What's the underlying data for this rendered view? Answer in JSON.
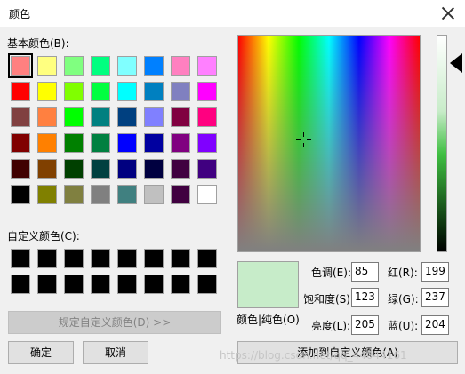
{
  "window": {
    "title": "颜色"
  },
  "basic": {
    "label": "基本颜色(B):",
    "swatches": [
      "#ff8080",
      "#ffff80",
      "#80ff80",
      "#00ff80",
      "#80ffff",
      "#0080ff",
      "#ff80c0",
      "#ff80ff",
      "#ff0000",
      "#ffff00",
      "#80ff00",
      "#00ff40",
      "#00ffff",
      "#0080c0",
      "#8080c0",
      "#ff00ff",
      "#804040",
      "#ff8040",
      "#00ff00",
      "#008080",
      "#004080",
      "#8080ff",
      "#800040",
      "#ff0080",
      "#800000",
      "#ff8000",
      "#008000",
      "#008040",
      "#0000ff",
      "#0000a0",
      "#800080",
      "#8000ff",
      "#400000",
      "#804000",
      "#004000",
      "#004040",
      "#000080",
      "#000040",
      "#400040",
      "#400080",
      "#000000",
      "#808000",
      "#808040",
      "#808080",
      "#408080",
      "#c0c0c0",
      "#400040",
      "#ffffff"
    ]
  },
  "custom": {
    "label": "自定义颜色(C):",
    "swatches": [
      "#000000",
      "#000000",
      "#000000",
      "#000000",
      "#000000",
      "#000000",
      "#000000",
      "#000000",
      "#000000",
      "#000000",
      "#000000",
      "#000000",
      "#000000",
      "#000000",
      "#000000",
      "#000000"
    ]
  },
  "buttons": {
    "define_custom": "规定自定义颜色(D) >>",
    "ok": "确定",
    "cancel": "取消",
    "add_custom": "添加到自定义颜色(A)"
  },
  "preview": {
    "color": "#c7ecc9",
    "label": "颜色|纯色(O)"
  },
  "hsl": {
    "hue_label": "色调(E):",
    "hue": "85",
    "sat_label": "饱和度(S):",
    "sat": "123",
    "lum_label": "亮度(L):",
    "lum": "205"
  },
  "rgb": {
    "red_label": "红(R):",
    "red": "199",
    "green_label": "绿(G):",
    "green": "237",
    "blue_label": "蓝(U):",
    "blue": "204"
  },
  "watermark": "https://blog.csdn.net/qq_44044161",
  "icons": {
    "close": "close-icon",
    "crosshair": "crosshair-icon",
    "lum_pointer": "arrow-left-icon"
  }
}
